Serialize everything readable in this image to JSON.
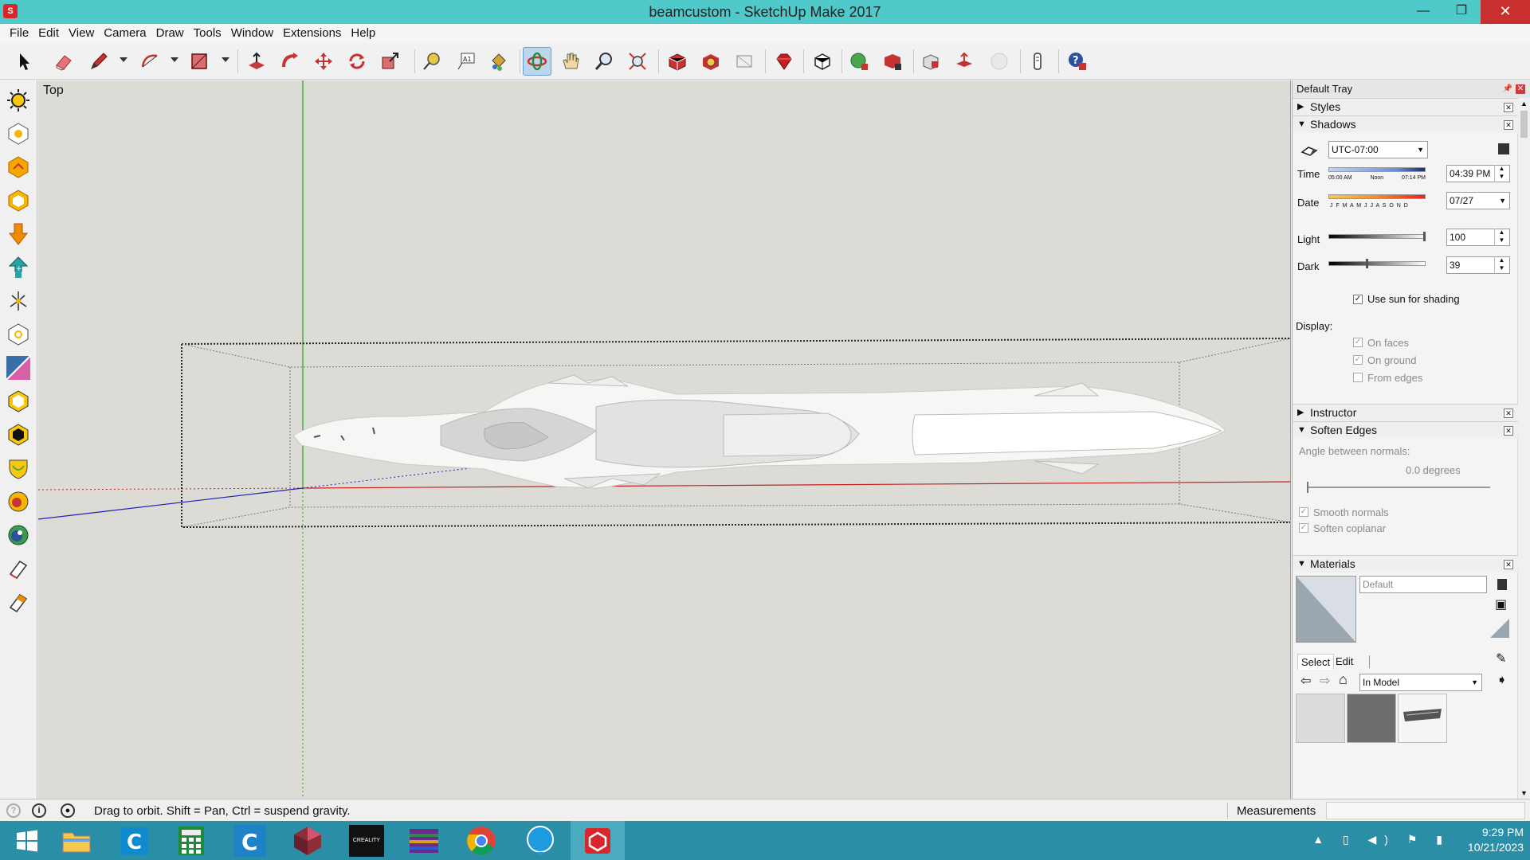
{
  "window": {
    "title": "beamcustom - SketchUp Make 2017",
    "app_icon_label": "S",
    "minimize": "—",
    "maximize": "❐",
    "close": "✕"
  },
  "menu": [
    "File",
    "Edit",
    "View",
    "Camera",
    "Draw",
    "Tools",
    "Window",
    "Extensions",
    "Help"
  ],
  "toolbar": {
    "icons": [
      "select-icon",
      "eraser-icon",
      "pencil-icon",
      "arc-icon",
      "rectangle-icon",
      "push-pull-icon",
      "follow-me-icon",
      "move-icon",
      "rotate-icon",
      "scale-icon",
      "tape-measure-icon",
      "text-icon",
      "paint-bucket-icon",
      "orbit-icon",
      "pan-icon",
      "zoom-icon",
      "zoom-extents-icon",
      "3d-warehouse-icon",
      "extension-warehouse-icon",
      "layout-icon",
      "ruby-icon",
      "section-plane-icon",
      "add-location-icon",
      "toggle-terrain-icon",
      "photo-texture-icon",
      "share-model-icon",
      "preview-icon",
      "walk-icon",
      "help-icon"
    ]
  },
  "viewport": {
    "view_label": "Top"
  },
  "status": {
    "text": "Drag to orbit. Shift = Pan, Ctrl = suspend gravity.",
    "measurements_label": "Measurements",
    "measurements_value": ""
  },
  "tray": {
    "title": "Default Tray",
    "pin": "📌",
    "close": "✕",
    "panels": {
      "styles": "Styles",
      "shadows": "Shadows",
      "instructor": "Instructor",
      "soften_edges": "Soften Edges",
      "materials": "Materials"
    },
    "shadows": {
      "timezone": "UTC-07:00",
      "time_label": "Time",
      "time_scale": [
        "05:00 AM",
        "Noon",
        "07:14 PM"
      ],
      "time_value": "04:39 PM",
      "date_label": "Date",
      "date_scale": "J F M A M J J A S O N D",
      "date_value": "07/27",
      "light_label": "Light",
      "light_value": "100",
      "light_level": 100,
      "dark_label": "Dark",
      "dark_value": "39",
      "dark_level": 39,
      "use_sun": "Use sun for shading",
      "display_label": "Display:",
      "on_faces": "On faces",
      "on_ground": "On ground",
      "from_edges": "From edges"
    },
    "soften": {
      "angle_label": "Angle between normals:",
      "angle_value": "0.0  degrees",
      "smooth_normals": "Smooth normals",
      "soften_coplanar": "Soften coplanar"
    },
    "materials": {
      "name": "Default",
      "tab_select": "Select",
      "tab_edit": "Edit",
      "collection": "In Model"
    }
  },
  "taskbar": {
    "apps": [
      "windows-start-icon",
      "file-explorer-icon",
      "ccleaner-icon",
      "calculator-icon",
      "cura-icon",
      "3d-app-icon",
      "creality-icon",
      "winrar-icon",
      "chrome-icon",
      "app-circle-icon",
      "sketchup-icon"
    ],
    "creality_label": "CREALITY",
    "time": "9:29 PM",
    "date": "10/21/2023"
  },
  "colors": {
    "titlebar": "#4fc9c9",
    "taskbar": "#2a8fa6",
    "viewport": "#dcdbd6",
    "red_axis": "#c82020",
    "green_axis": "#1fa81f",
    "blue_axis": "#2020c0"
  }
}
